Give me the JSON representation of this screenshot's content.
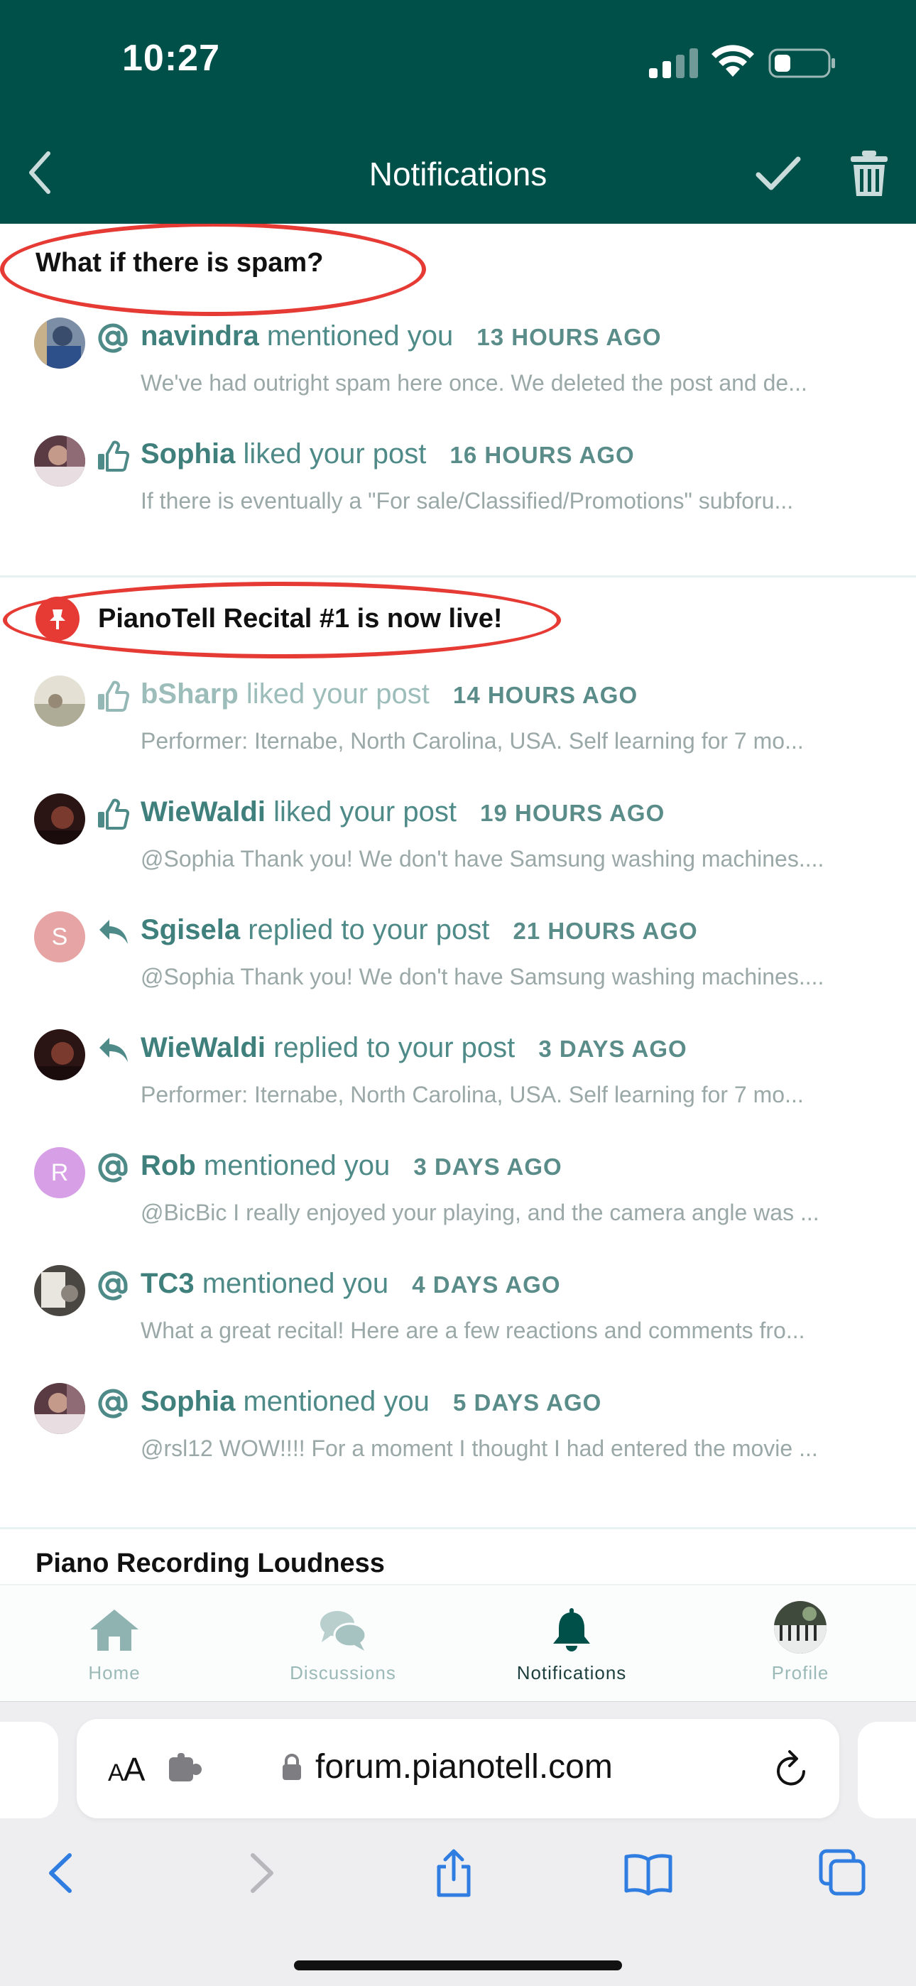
{
  "status_bar": {
    "time": "10:27"
  },
  "nav": {
    "title": "Notifications"
  },
  "groups": [
    {
      "title": "What if there is spam?",
      "items": [
        {
          "type": "mention",
          "user": "navindra",
          "action": "mentioned you",
          "time": "13 HOURS AGO",
          "excerpt": "We've had outright spam here once. We deleted the post and de..."
        },
        {
          "type": "like",
          "user": "Sophia",
          "action": "liked your post",
          "time": "16 HOURS AGO",
          "excerpt": "If there is eventually a \"For sale/Classified/Promotions\" subforu..."
        }
      ]
    },
    {
      "title": "PianoTell Recital #1 is now live!",
      "items": [
        {
          "type": "like",
          "user": "bSharp",
          "action": "liked your post",
          "time": "14 HOURS AGO",
          "excerpt": "Performer: Iternabe, North Carolina, USA. Self learning for 7 mo..."
        },
        {
          "type": "like",
          "user": "WieWaldi",
          "action": "liked your post",
          "time": "19 HOURS AGO",
          "excerpt": "@Sophia Thank you! We don't have Samsung washing machines...."
        },
        {
          "type": "reply",
          "user": "Sgisela",
          "avatar_letter": "S",
          "action": "replied to your post",
          "time": "21 HOURS AGO",
          "excerpt": "@Sophia Thank you! We don't have Samsung washing machines...."
        },
        {
          "type": "reply",
          "user": "WieWaldi",
          "action": "replied to your post",
          "time": "3 DAYS AGO",
          "excerpt": "Performer: Iternabe, North Carolina, USA. Self learning for 7 mo..."
        },
        {
          "type": "mention",
          "user": "Rob",
          "avatar_letter": "R",
          "action": "mentioned you",
          "time": "3 DAYS AGO",
          "excerpt": "@BicBic I really enjoyed your playing, and the camera angle was ..."
        },
        {
          "type": "mention",
          "user": "TC3",
          "action": "mentioned you",
          "time": "4 DAYS AGO",
          "excerpt": "What a great recital! Here are a few reactions and comments fro..."
        },
        {
          "type": "mention",
          "user": "Sophia",
          "action": "mentioned you",
          "time": "5 DAYS AGO",
          "excerpt": "@rsl12 WOW!!!! For a moment I thought I had entered the movie ..."
        }
      ]
    },
    {
      "title": "Piano Recording Loudness",
      "items": []
    }
  ],
  "tabbar": {
    "home": "Home",
    "discussions": "Discussions",
    "notifications": "Notifications",
    "profile": "Profile"
  },
  "browser": {
    "aa_big": "A",
    "aa_small": "A",
    "url": "forum.pianotell.com"
  },
  "colors": {
    "header": "#00504a",
    "accent": "#3f7f7c",
    "annotation_red": "#e63a34",
    "ios_blue": "#2f7de1"
  }
}
